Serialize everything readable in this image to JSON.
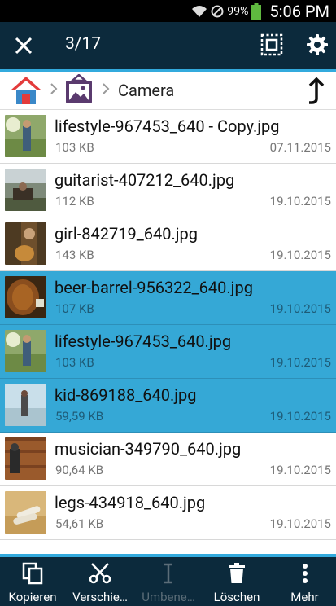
{
  "status_bar": {
    "battery": "99%",
    "time": "5:06 PM"
  },
  "action_bar": {
    "counter": "3/17"
  },
  "breadcrumb": {
    "current": "Camera"
  },
  "files": [
    {
      "name": "lifestyle-967453_640 - Copy.jpg",
      "size": "103 KB",
      "date": "07.11.2015",
      "selected": false
    },
    {
      "name": "guitarist-407212_640.jpg",
      "size": "112 KB",
      "date": "19.10.2015",
      "selected": false
    },
    {
      "name": "girl-842719_640.jpg",
      "size": "143 KB",
      "date": "19.10.2015",
      "selected": false
    },
    {
      "name": "beer-barrel-956322_640.jpg",
      "size": "107 KB",
      "date": "19.10.2015",
      "selected": true
    },
    {
      "name": "lifestyle-967453_640.jpg",
      "size": "103 KB",
      "date": "19.10.2015",
      "selected": true
    },
    {
      "name": "kid-869188_640.jpg",
      "size": "59,59 KB",
      "date": "19.10.2015",
      "selected": true
    },
    {
      "name": "musician-349790_640.jpg",
      "size": "90,64 KB",
      "date": "19.10.2015",
      "selected": false
    },
    {
      "name": "legs-434918_640.jpg",
      "size": "54,61 KB",
      "date": "19.10.2015",
      "selected": false
    }
  ],
  "bottom_bar": {
    "copy": "Kopieren",
    "move": "Verschie…",
    "rename": "Umbene…",
    "delete": "Löschen",
    "more": "Mehr"
  }
}
